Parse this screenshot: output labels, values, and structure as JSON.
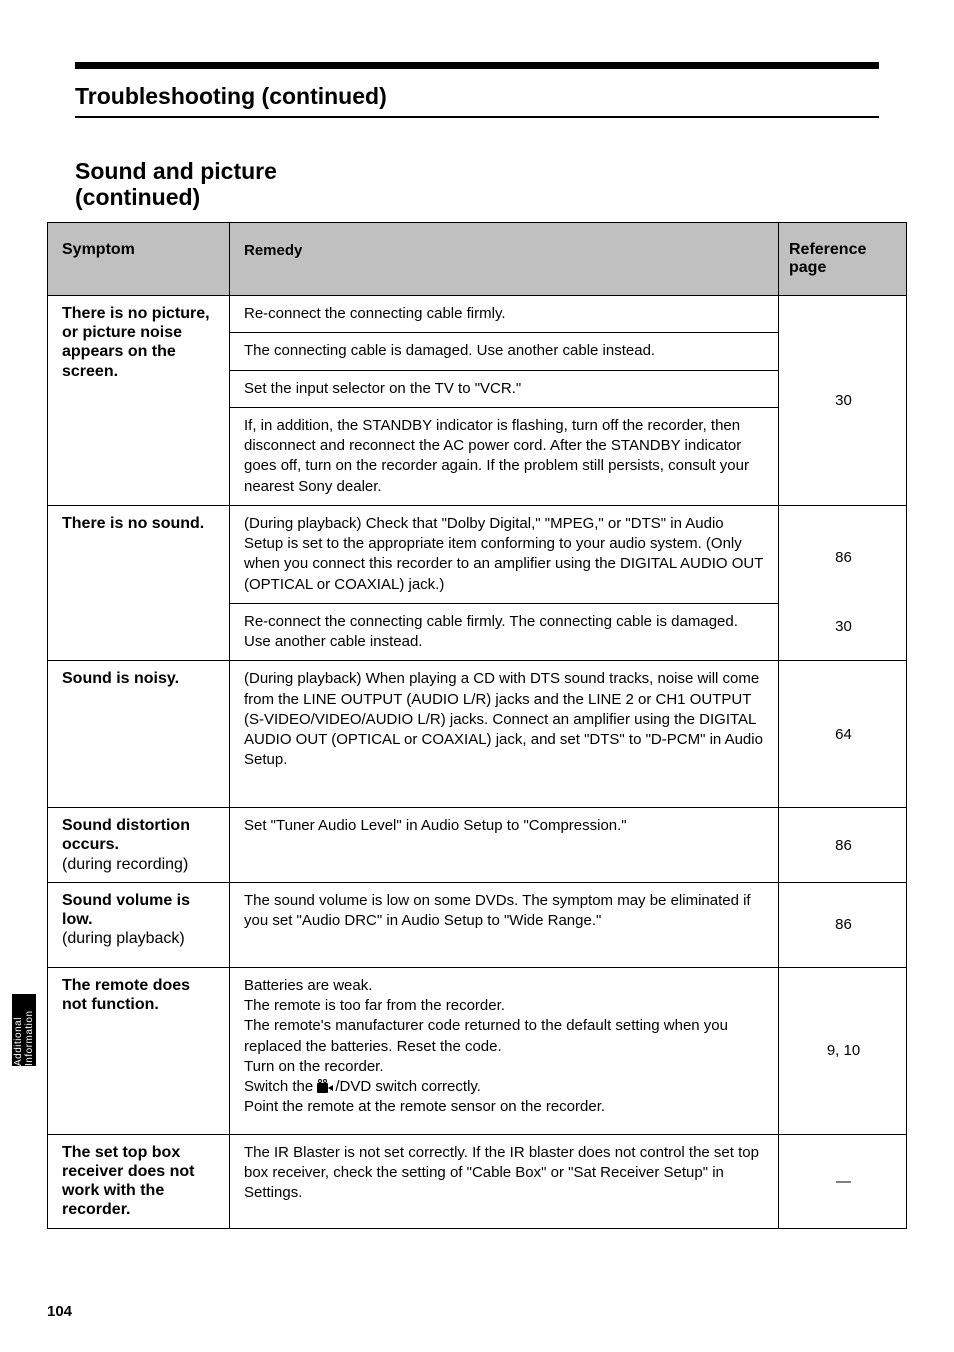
{
  "page": {
    "running_title": "Troubleshooting (continued)",
    "section": "Sound and picture",
    "subsection": "(continued)",
    "side_tab": "Additional Information",
    "page_number": "104"
  },
  "table": {
    "headers": {
      "symptom": "Symptom",
      "remedy": "Remedy",
      "page": "Reference page"
    },
    "rows": [
      {
        "symptom": "There is no picture, or picture noise appears on the screen.",
        "remedies": [
          {
            "text": "Re-connect the connecting cable firmly.",
            "page": "30"
          },
          {
            "text": "The connecting cable is damaged. Use another cable instead.",
            "page": "30"
          },
          {
            "text": "Set the input selector on the TV to \"VCR.\"",
            "page": "30"
          },
          {
            "text": "If, in addition, the STANDBY indicator is flashing, turn off the recorder, then disconnect and reconnect the AC power cord. After the STANDBY indicator goes off, turn on the recorder again. If the problem still persists, consult your nearest Sony dealer.",
            "page": "30"
          }
        ]
      },
      {
        "symptom": "There is no sound.",
        "remedies": [
          {
            "text": "(During playback) Check that \"Dolby Digital,\" \"MPEG,\" or \"DTS\" in Audio Setup is set to the appropriate item conforming to your audio system. (Only when you connect this recorder to an amplifier using the DIGITAL AUDIO OUT (OPTICAL or COAXIAL) jack.)",
            "page": "86"
          },
          {
            "text": "Re-connect the connecting cable firmly. The connecting cable is damaged. Use another cable instead.",
            "page": "30"
          }
        ]
      },
      {
        "symptom": "Sound is noisy.",
        "remedies": [
          {
            "text": "(During playback) When playing a CD with DTS sound tracks, noise will come from the LINE OUTPUT (AUDIO L/R) jacks and the LINE 2 or CH1 OUTPUT (S-VIDEO/VIDEO/AUDIO L/R) jacks. Connect an amplifier using the DIGITAL AUDIO OUT (OPTICAL or COAXIAL) jack, and set \"DTS\" to \"D-PCM\" in Audio Setup.",
            "page": "64"
          }
        ]
      },
      {
        "symptom_html": "<span class=\"name\">Sound distortion occurs.<br></span><span style=\"font-weight:400\">(during recording)</span>",
        "remedies": [
          {
            "text": "Set \"Tuner Audio Level\" in Audio Setup to \"Compression.\"",
            "page": "86"
          }
        ]
      },
      {
        "symptom_html": "<span class=\"name\">Sound volume is low.<br></span><span style=\"font-weight:400\">(during playback)</span>",
        "remedies": [
          {
            "text": "The sound volume is low on some DVDs. The symptom may be eliminated if you set \"Audio DRC\" in Audio Setup to \"Wide Range.\"",
            "page": "86"
          }
        ]
      },
      {
        "symptom": "The remote does not function.",
        "remedies": [
          {
            "text_html": "Batteries are weak.<br>The remote is too far from the recorder.<br>The remote's manufacturer code returned to the default setting when you replaced the batteries. Reset the code.<br>Turn on the recorder.<br>Switch the <span class=\"camicon\"><span class=\"reels\"></span></span>/DVD switch correctly.<br>Point the remote at the remote sensor on the recorder.",
            "page": "9, 10"
          }
        ]
      },
      {
        "symptom": "The set top box receiver does not work with the recorder.",
        "remedies": [
          {
            "text": "The IR Blaster is not set correctly. If the IR blaster does not control the set top box receiver, check the setting of \"Cable Box\" or \"Sat Receiver Setup\" in Settings.",
            "page": "—"
          }
        ]
      }
    ]
  }
}
